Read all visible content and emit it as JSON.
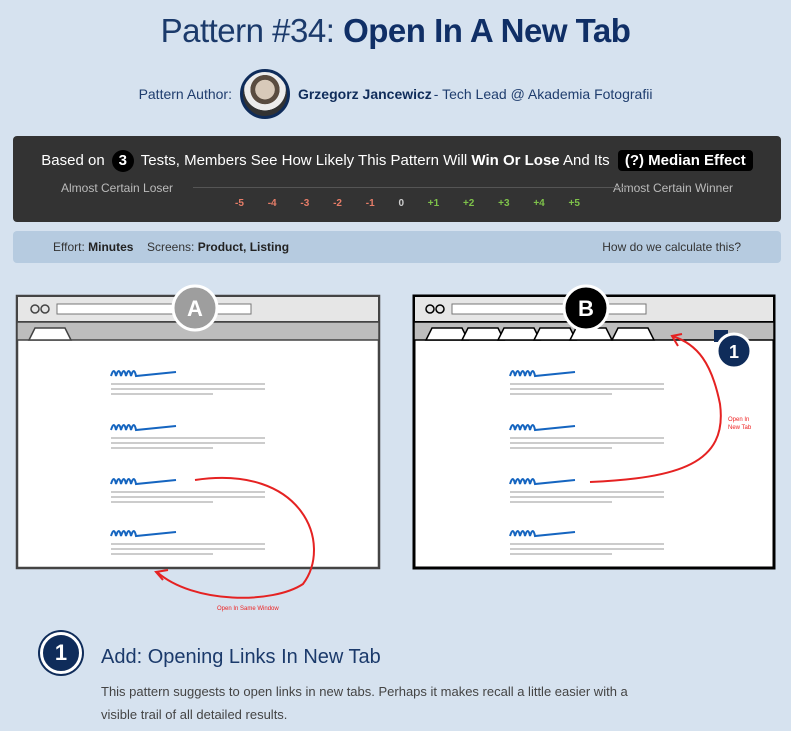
{
  "header": {
    "title_prefix": "Pattern #34: ",
    "title_name": "Open In A New Tab"
  },
  "author": {
    "label": "Pattern Author:",
    "name": "Grzegorz Jancewicz",
    "role": " - Tech Lead @ Akademia Fotografii"
  },
  "results": {
    "based_on": "Based on",
    "tests_count": "3",
    "text_middle": "Tests, Members See How Likely This Pattern Will",
    "win_or_lose": "Win Or Lose",
    "and_its": "And Its",
    "median_effect": "(?) Median Effect",
    "scale_left_label": "Almost Certain Loser",
    "scale_right_label": "Almost Certain Winner",
    "ticks": [
      "-5",
      "-4",
      "-3",
      "-2",
      "-1",
      "0",
      "+1",
      "+2",
      "+3",
      "+4",
      "+5"
    ],
    "colors": {
      "negative": "#e77d68",
      "neutral": "#cfcfcf",
      "positive": "#7ec24a"
    }
  },
  "info": {
    "effort_label": "Effort:",
    "effort_value": "Minutes",
    "screens_label": "Screens:",
    "screens_value": "Product, Listing",
    "calc_link": "How do we calculate this?"
  },
  "variants": {
    "a_label": "A",
    "b_label": "B",
    "a_caption": "Open In Same Window",
    "b_caption_line1": "Open In",
    "b_caption_line2": "New Tab",
    "b_marker": "1"
  },
  "step": {
    "number": "1",
    "title": "Add: Opening Links In New Tab",
    "description": "This pattern suggests to open links in new tabs. Perhaps it makes recall a little easier with a visible trail of all detailed results."
  },
  "colors": {
    "brand_navy": "#0f2c5a",
    "background": "#d6e2ef",
    "panel_dark": "#333333",
    "info_bar": "#b6cbe0",
    "sketch_link_blue": "#1565c0",
    "arrow_red": "#e52222"
  }
}
